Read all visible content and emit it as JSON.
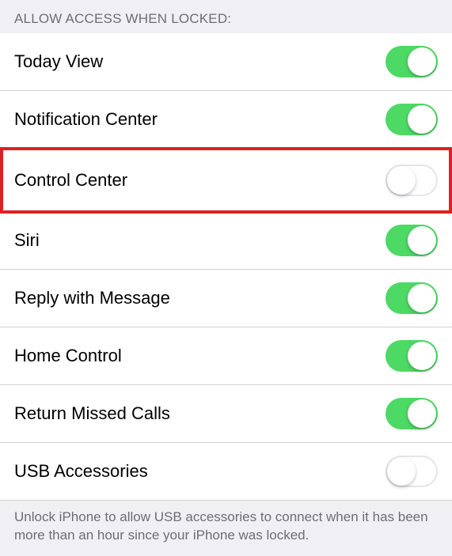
{
  "section": {
    "header": "Allow Access When Locked:",
    "footer": "Unlock iPhone to allow USB accessories to connect when it has been more than an hour since your iPhone was locked.",
    "items": [
      {
        "label": "Today View",
        "enabled": true,
        "highlighted": false
      },
      {
        "label": "Notification Center",
        "enabled": true,
        "highlighted": false
      },
      {
        "label": "Control Center",
        "enabled": false,
        "highlighted": true
      },
      {
        "label": "Siri",
        "enabled": true,
        "highlighted": false
      },
      {
        "label": "Reply with Message",
        "enabled": true,
        "highlighted": false
      },
      {
        "label": "Home Control",
        "enabled": true,
        "highlighted": false
      },
      {
        "label": "Return Missed Calls",
        "enabled": true,
        "highlighted": false
      },
      {
        "label": "USB Accessories",
        "enabled": false,
        "highlighted": false
      }
    ]
  }
}
